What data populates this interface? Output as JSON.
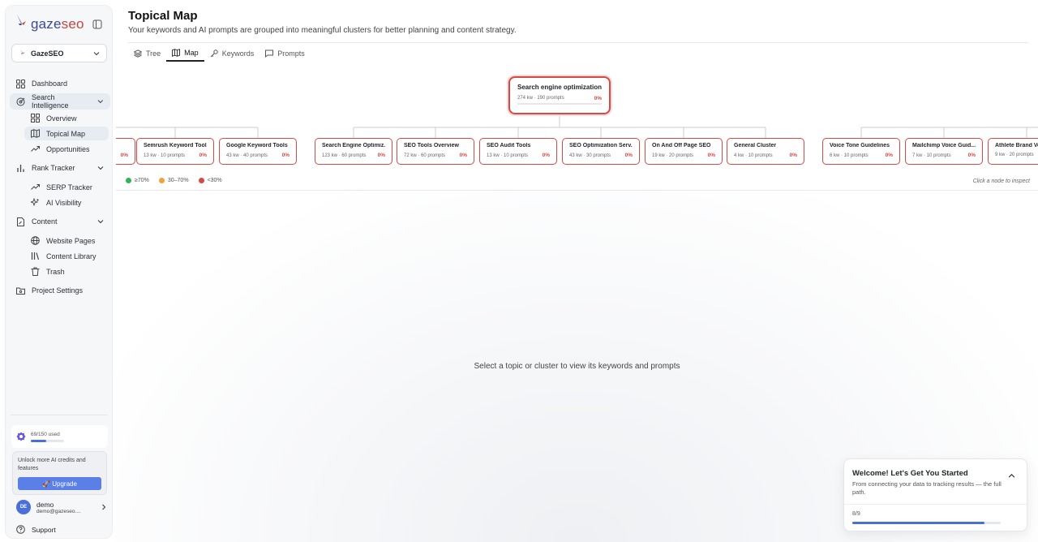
{
  "app": {
    "logo_text": "gaze",
    "logo_text_accent": "seo",
    "project_name": "GazeSEO"
  },
  "sidebar": {
    "nav": {
      "dashboard": "Dashboard",
      "search_intelligence": "Search Intelligence",
      "overview": "Overview",
      "topical_map": "Topical Map",
      "opportunities": "Opportunities",
      "rank_tracker": "Rank Tracker",
      "serp_tracker": "SERP Tracker",
      "ai_visibility": "AI Visibility",
      "content": "Content",
      "website_pages": "Website Pages",
      "content_library": "Content Library",
      "trash": "Trash",
      "project_settings": "Project Settings"
    },
    "credits": {
      "label": "69/150 used",
      "used": 69,
      "total": 150
    },
    "upgrade": {
      "text": "Unlock more AI credits and features",
      "button": "🚀 Upgrade"
    },
    "user": {
      "initials": "DE",
      "name": "demo",
      "email": "demo@gazeseo...."
    },
    "support": "Support"
  },
  "header": {
    "title": "Topical Map",
    "subtitle": "Your keywords and AI prompts are grouped into meaningful clusters for better planning and content strategy."
  },
  "tabs": [
    {
      "label": "Tree",
      "icon": "layers-icon"
    },
    {
      "label": "Map",
      "icon": "map-icon"
    },
    {
      "label": "Keywords",
      "icon": "key-icon"
    },
    {
      "label": "Prompts",
      "icon": "message-icon"
    }
  ],
  "map": {
    "root": {
      "title": "Search engine optimization",
      "meta": "274 kw · 190 prompts",
      "pct": "0%",
      "progress": 0
    },
    "clusters": [
      {
        "title": "…",
        "meta": "",
        "pct": "0%"
      },
      {
        "title": "Semrush Keyword Tools",
        "meta": "13 kw · 10 prompts",
        "pct": "0%"
      },
      {
        "title": "Google Keyword Tools",
        "meta": "43 kw · 40 prompts",
        "pct": "0%"
      },
      {
        "title": "Search Engine Optimiz...",
        "meta": "123 kw · 60 prompts",
        "pct": "0%"
      },
      {
        "title": "SEO Tools Overview",
        "meta": "72 kw · 60 prompts",
        "pct": "0%"
      },
      {
        "title": "SEO Audit Tools",
        "meta": "13 kw · 10 prompts",
        "pct": "0%"
      },
      {
        "title": "SEO Optimization Serv...",
        "meta": "43 kw · 30 prompts",
        "pct": "0%"
      },
      {
        "title": "On And Off Page SEO",
        "meta": "19 kw · 20 prompts",
        "pct": "0%"
      },
      {
        "title": "General Cluster",
        "meta": "4 kw · 10 prompts",
        "pct": "0%"
      },
      {
        "title": "Voice Tone Guidelines",
        "meta": "6 kw · 10 prompts",
        "pct": "0%"
      },
      {
        "title": "Mailchimp Voice Guid...",
        "meta": "7 kw · 10 prompts",
        "pct": "0%"
      },
      {
        "title": "Athlete Brand Vo",
        "meta": "9 kw · 20 prompts",
        "pct": ""
      }
    ],
    "legend": [
      {
        "label": "≥70%",
        "color": "#2fb45a"
      },
      {
        "label": "30–70%",
        "color": "#f0a23b"
      },
      {
        "label": "<30%",
        "color": "#d64a45"
      }
    ],
    "hint": "Click a node to inspect"
  },
  "detail": {
    "empty_message": "Select a topic or cluster to view its keywords and prompts"
  },
  "welcome": {
    "title": "Welcome! Let's Get You Started",
    "subtitle": "From connecting your data to tracking results — the full path.",
    "progress_label": "8/9",
    "progress": 0.889
  }
}
